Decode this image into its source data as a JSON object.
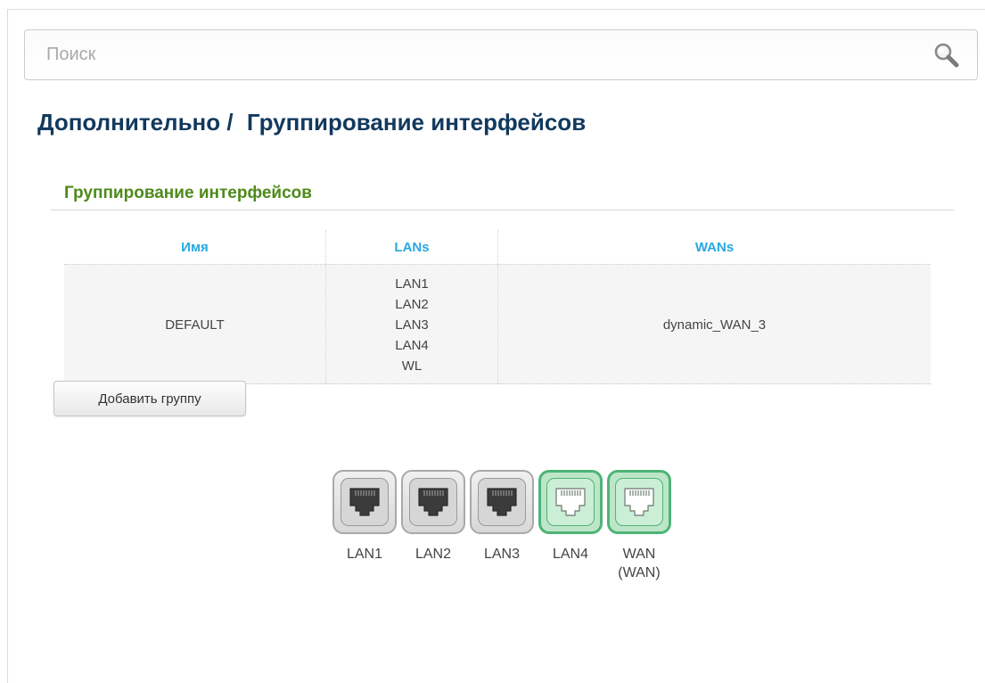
{
  "search": {
    "placeholder": "Поиск"
  },
  "breadcrumb": {
    "parent": "Дополнительно",
    "separator": "/",
    "current": "Группирование интерфейсов"
  },
  "section": {
    "title": "Группирование интерфейсов"
  },
  "table": {
    "headers": [
      "Имя",
      "LANs",
      "WANs"
    ],
    "rows": [
      {
        "name": "DEFAULT",
        "lans": [
          "LAN1",
          "LAN2",
          "LAN3",
          "LAN4",
          "WL"
        ],
        "wans": "dynamic_WAN_3"
      }
    ]
  },
  "add_group_button": "Добавить группу",
  "ports": [
    {
      "label": "LAN1",
      "status": "inactive"
    },
    {
      "label": "LAN2",
      "status": "inactive"
    },
    {
      "label": "LAN3",
      "status": "inactive"
    },
    {
      "label": "LAN4",
      "status": "active"
    },
    {
      "label": "WAN",
      "sublabel": "(WAN)",
      "status": "active"
    }
  ],
  "colors": {
    "title": "#12395e",
    "section_title": "#4e8a1a",
    "table_header": "#29a8e0",
    "port_active": "#4db476",
    "port_inactive": "#a9a9a9"
  }
}
